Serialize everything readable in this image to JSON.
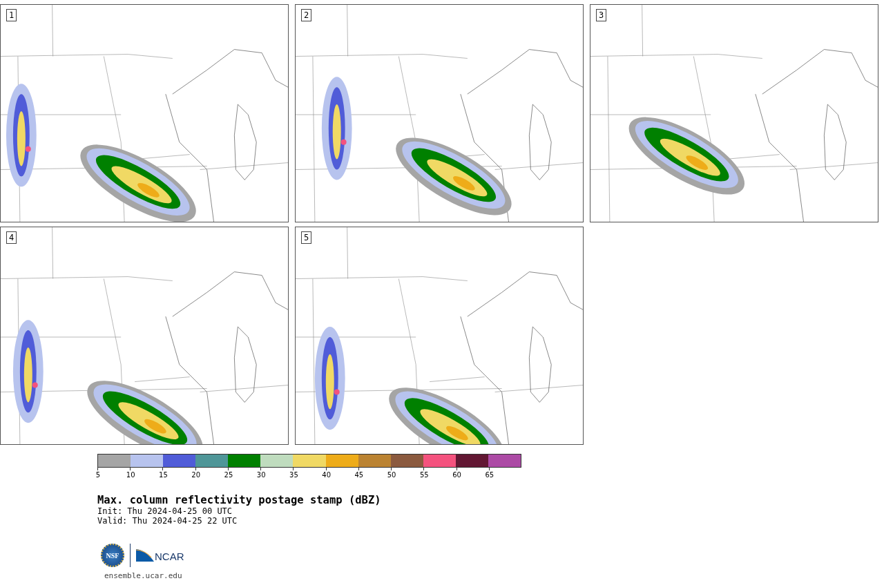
{
  "panels": [
    {
      "label": "1"
    },
    {
      "label": "2"
    },
    {
      "label": "3"
    },
    {
      "label": "4"
    },
    {
      "label": "5"
    }
  ],
  "colorbar": {
    "bins": [
      {
        "color": "#a5a5a5"
      },
      {
        "color": "#b7c3ee"
      },
      {
        "color": "#505cd8"
      },
      {
        "color": "#4f9698"
      },
      {
        "color": "#008000"
      },
      {
        "color": "#bfdcbe"
      },
      {
        "color": "#f0d964"
      },
      {
        "color": "#eeac19"
      },
      {
        "color": "#bb8332"
      },
      {
        "color": "#8b5a3f"
      },
      {
        "color": "#f4527e"
      },
      {
        "color": "#621733"
      },
      {
        "color": "#ac4aa5"
      }
    ],
    "ticks": [
      "5",
      "10",
      "15",
      "20",
      "25",
      "30",
      "35",
      "40",
      "45",
      "50",
      "55",
      "60",
      "65"
    ]
  },
  "title": "Max. column reflectivity postage stamp (dBZ)",
  "init": " Init: Thu 2024-04-25 00 UTC",
  "valid": "Valid: Thu 2024-04-25 22 UTC",
  "logo": {
    "nsf": "NSF",
    "ncar": "NCAR"
  },
  "site": "ensemble.ucar.edu"
}
